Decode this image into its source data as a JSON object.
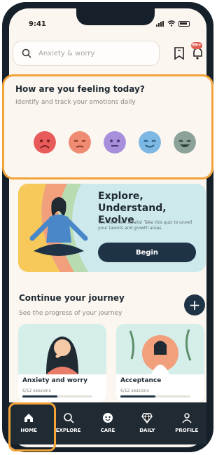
{
  "status": {
    "time": "9:41"
  },
  "search": {
    "placeholder": "Anxiety & worry"
  },
  "header": {
    "notification_badge": "99+"
  },
  "feeling": {
    "title": "How are you feeling today?",
    "subtitle": "Identify and track your emotions daily",
    "moods": [
      {
        "name": "very-sad",
        "color": "#e85b5b"
      },
      {
        "name": "sad",
        "color": "#ef8b72"
      },
      {
        "name": "neutral",
        "color": "#a78fdc"
      },
      {
        "name": "calm",
        "color": "#7cb8e3"
      },
      {
        "name": "happy",
        "color": "#8da39a"
      }
    ]
  },
  "explore": {
    "title": "Explore, Understand, Evolve",
    "subtitle": "Your best self awaits! Take this quiz to unveil your talents and growth areas.",
    "button": "Begin"
  },
  "journey": {
    "title": "Continue your journey",
    "subtitle": "See the progress of your journey",
    "cards": [
      {
        "title": "Anxiety and worry",
        "sessions": "6/12 sessions",
        "progress": 0.5
      },
      {
        "title": "Acceptance",
        "sessions": "6/12 sessions",
        "progress": 0.5
      }
    ]
  },
  "nav": [
    {
      "label": "HOME",
      "icon": "home-icon"
    },
    {
      "label": "EXPLORE",
      "icon": "search-icon"
    },
    {
      "label": "CARE",
      "icon": "care-icon"
    },
    {
      "label": "DAILY",
      "icon": "diamond-icon"
    },
    {
      "label": "PROFILE",
      "icon": "profile-icon"
    }
  ],
  "colors": {
    "accent": "#f2a33a",
    "dark": "#1f3346"
  }
}
